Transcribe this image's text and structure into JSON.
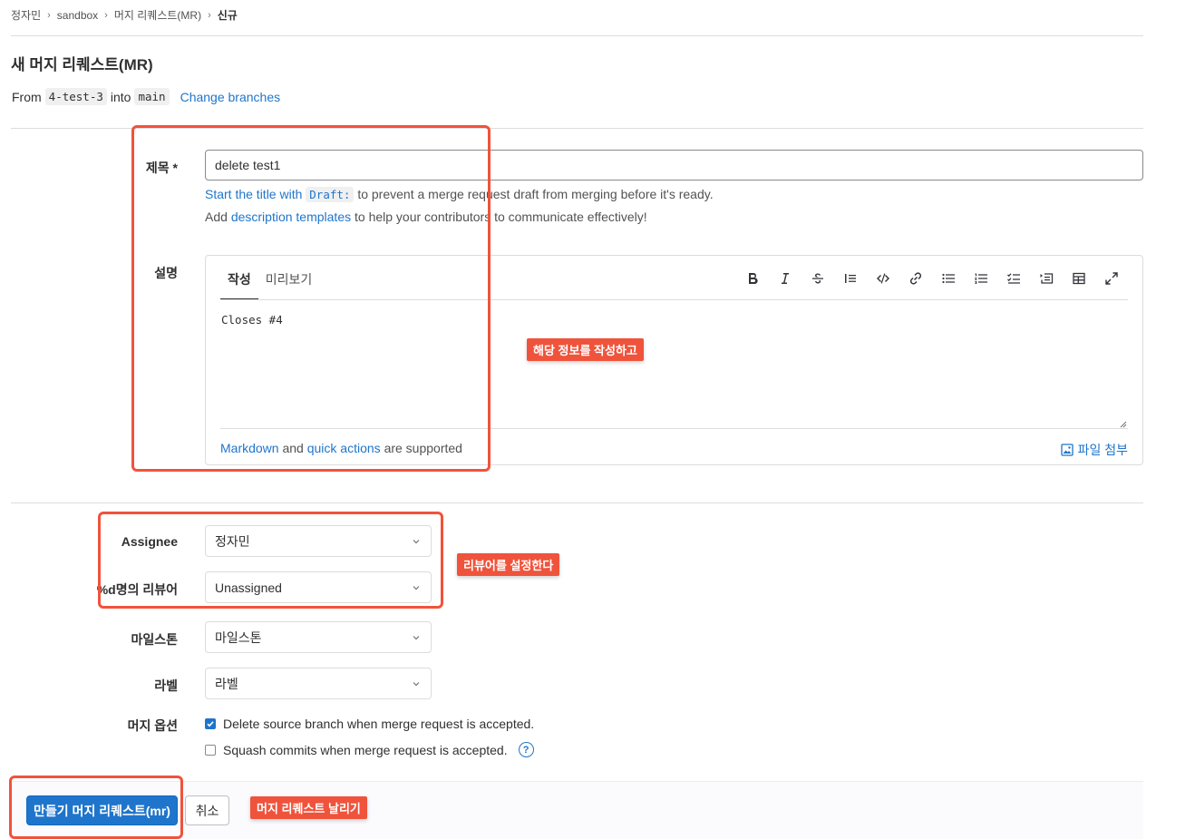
{
  "breadcrumb": {
    "items": [
      "정자민",
      "sandbox",
      "머지 리퀘스트(MR)"
    ],
    "current": "신규",
    "separator": "›"
  },
  "page": {
    "title": "새 머지 리퀘스트(MR)",
    "from_label": "From",
    "source_branch": "4-test-3",
    "into_label": "into",
    "target_branch": "main",
    "change_branches": "Change branches"
  },
  "title_field": {
    "label": "제목 *",
    "value": "delete test1",
    "hint1_link": "Start the title with",
    "hint1_code": "Draft:",
    "hint1_rest": "to prevent a merge request draft from merging before it's ready.",
    "hint2_prefix": "Add",
    "hint2_link": "description templates",
    "hint2_rest": "to help your contributors to communicate effectively!"
  },
  "description": {
    "label": "설명",
    "tabs": [
      "작성",
      "미리보기"
    ],
    "active_tab": "작성",
    "value": "Closes #4",
    "toolbar_icons": [
      "bold-icon",
      "italic-icon",
      "strikethrough-icon",
      "quote-icon",
      "code-icon",
      "link-icon",
      "bullet-list-icon",
      "numbered-list-icon",
      "task-list-icon",
      "collapsible-icon",
      "table-icon",
      "fullscreen-icon"
    ],
    "footer_link1": "Markdown",
    "footer_and": "and",
    "footer_link2": "quick actions",
    "footer_rest": "are supported",
    "attach_label": "파일 첨부"
  },
  "assignee": {
    "label": "Assignee",
    "value": "정자민"
  },
  "reviewer": {
    "label": "%d명의 리뷰어",
    "value": "Unassigned"
  },
  "milestone": {
    "label": "마일스톤",
    "value": "마일스톤"
  },
  "labels": {
    "label": "라벨",
    "value": "라벨"
  },
  "merge_options": {
    "label": "머지 옵션",
    "delete_source": {
      "text": "Delete source branch when merge request is accepted.",
      "checked": true
    },
    "squash": {
      "text": "Squash commits when merge request is accepted.",
      "checked": false
    }
  },
  "actions": {
    "submit": "만들기 머지 리퀘스트(mr)",
    "cancel": "취소"
  },
  "annotations": {
    "tag1": "해당 정보를 작성하고",
    "tag2": "리뷰어를 설정한다",
    "tag3": "머지 리퀘스트 날리기",
    "color": "#f0533b"
  },
  "colors": {
    "link": "#1f75cb",
    "primary": "#1f75cb"
  }
}
